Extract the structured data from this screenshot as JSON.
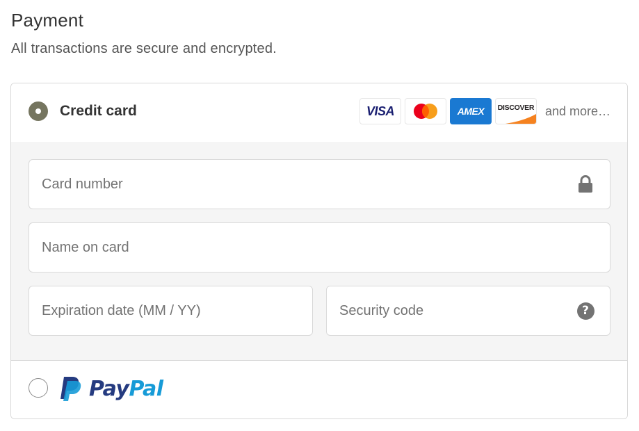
{
  "header": {
    "title": "Payment",
    "subtitle": "All transactions are secure and encrypted."
  },
  "credit_card": {
    "label": "Credit card",
    "selected": true,
    "logos": [
      {
        "name": "visa",
        "text": "VISA"
      },
      {
        "name": "mastercard",
        "text": ""
      },
      {
        "name": "amex",
        "text": "AMEX"
      },
      {
        "name": "discover",
        "text": "DISCOVER"
      }
    ],
    "and_more": "and more…",
    "fields": {
      "card_number_placeholder": "Card number",
      "name_on_card_placeholder": "Name on card",
      "expiration_placeholder": "Expiration date (MM / YY)",
      "security_code_placeholder": "Security code"
    },
    "icons": {
      "card_number": "lock-icon",
      "security_code": "help-circle-icon"
    }
  },
  "paypal": {
    "selected": false,
    "wordmark_part1": "Pay",
    "wordmark_part2": "Pal"
  },
  "colors": {
    "radio_selected": "#75755f",
    "border": "#d9d9d9",
    "fields_background": "#f5f5f5",
    "visa_blue": "#1a1f71",
    "mastercard_red": "#eb001b",
    "mastercard_yellow": "#f79e1b",
    "amex_blue": "#1a79d2",
    "discover_orange": "#f58220",
    "paypal_dark": "#253b80",
    "paypal_light": "#179bd7"
  }
}
